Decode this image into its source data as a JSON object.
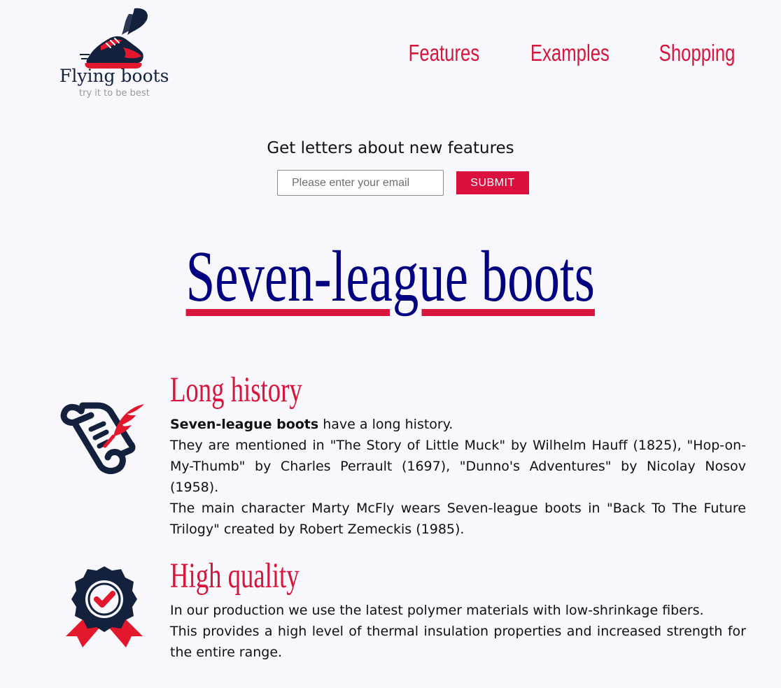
{
  "brand": {
    "name": "Flying boots",
    "tagline": "try it to be best"
  },
  "nav": [
    {
      "label": "Features"
    },
    {
      "label": "Examples"
    },
    {
      "label": "Shopping"
    }
  ],
  "subscribe": {
    "title": "Get letters about new features",
    "email_placeholder": "Please enter your email",
    "submit_label": "SUBMIT"
  },
  "main": {
    "title": "Seven-league boots"
  },
  "features": [
    {
      "heading": "Long history",
      "icon": "scroll-quill-icon",
      "intro_bold": "Seven-league boots",
      "intro_rest": " have a long history.",
      "lines": [
        "They are mentioned in \"The Story of Little Muck\" by Wilhelm Hauff (1825), \"Hop-on-My-Thumb\" by Charles Perrault (1697), \"Dunno's Adventures\" by Nicolay Nosov (1958).",
        "The main character Marty McFly wears Seven-league boots in \"Back To The Future Trilogy\" created by Robert Zemeckis (1985)."
      ]
    },
    {
      "heading": "High quality",
      "icon": "quality-badge-icon",
      "lines": [
        "In our production we use the latest polymer materials with low-shrinkage fibers.",
        "This provides a high level of thermal insulation properties and increased strength for the entire range."
      ]
    }
  ],
  "colors": {
    "accent": "#d8163c",
    "title_blue": "#000080",
    "dark_navy": "#14213d",
    "background": "#f7f7fc"
  }
}
